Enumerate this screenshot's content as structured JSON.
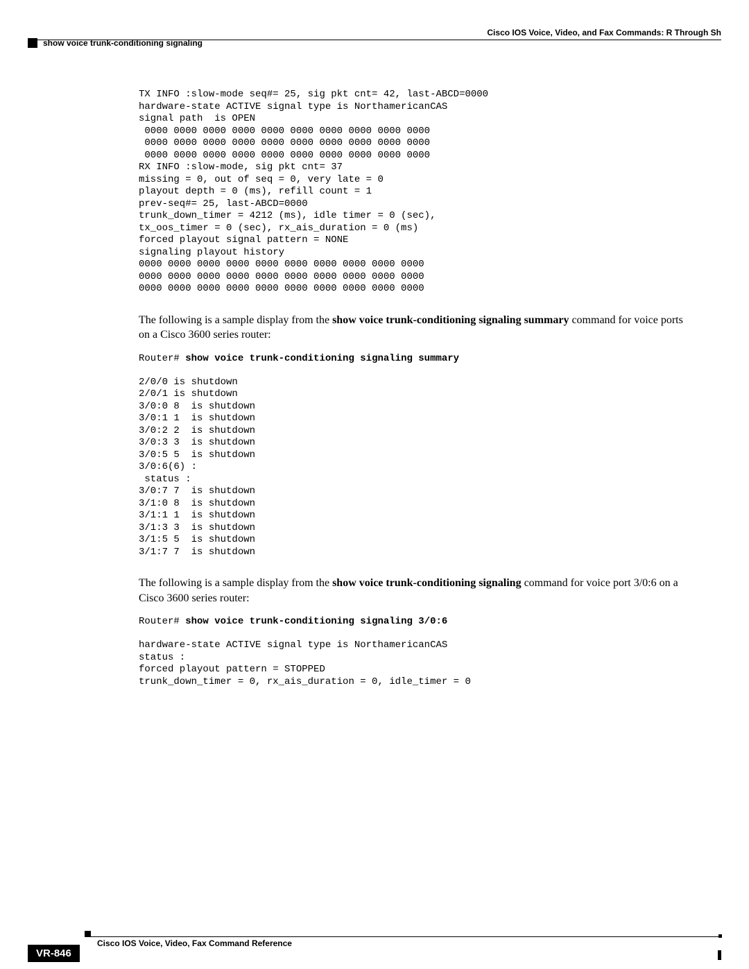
{
  "header": {
    "right_text": "Cisco IOS Voice, Video, and Fax Commands: R Through Sh",
    "left_text": "show voice trunk-conditioning signaling"
  },
  "block1": {
    "lines": [
      "TX INFO :slow-mode seq#= 25, sig pkt cnt= 42, last-ABCD=0000",
      "hardware-state ACTIVE signal type is NorthamericanCAS",
      "signal path  is OPEN",
      " 0000 0000 0000 0000 0000 0000 0000 0000 0000 0000",
      " 0000 0000 0000 0000 0000 0000 0000 0000 0000 0000",
      " 0000 0000 0000 0000 0000 0000 0000 0000 0000 0000",
      "RX INFO :slow-mode, sig pkt cnt= 37",
      "missing = 0, out of seq = 0, very late = 0",
      "playout depth = 0 (ms), refill count = 1",
      "prev-seq#= 25, last-ABCD=0000",
      "trunk_down_timer = 4212 (ms), idle timer = 0 (sec),",
      "tx_oos_timer = 0 (sec), rx_ais_duration = 0 (ms)",
      "forced playout signal pattern = NONE",
      "signaling playout history",
      "0000 0000 0000 0000 0000 0000 0000 0000 0000 0000",
      "0000 0000 0000 0000 0000 0000 0000 0000 0000 0000",
      "0000 0000 0000 0000 0000 0000 0000 0000 0000 0000"
    ]
  },
  "para1": {
    "pre": "The following is a sample display from the ",
    "bold": "show voice trunk-conditioning signaling summary",
    "post": " command for voice ports on a Cisco 3600 series router:"
  },
  "cmd1": {
    "prompt": "Router# ",
    "cmd": "show voice trunk-conditioning signaling summary"
  },
  "block2": {
    "lines": [
      "2/0/0 is shutdown",
      "2/0/1 is shutdown",
      "3/0:0 8  is shutdown",
      "3/0:1 1  is shutdown",
      "3/0:2 2  is shutdown",
      "3/0:3 3  is shutdown",
      "3/0:5 5  is shutdown",
      "3/0:6(6) :",
      " status :",
      "3/0:7 7  is shutdown",
      "3/1:0 8  is shutdown",
      "3/1:1 1  is shutdown",
      "3/1:3 3  is shutdown",
      "3/1:5 5  is shutdown",
      "3/1:7 7  is shutdown"
    ]
  },
  "para2": {
    "pre": "The following is a sample display from the ",
    "bold": "show voice trunk-conditioning signaling",
    "post": " command for voice port 3/0:6 on a Cisco 3600 series router:"
  },
  "cmd2": {
    "prompt": "Router# ",
    "cmd": "show voice trunk-conditioning signaling 3/0:6"
  },
  "block3": {
    "lines": [
      "hardware-state ACTIVE signal type is NorthamericanCAS",
      "status :",
      "forced playout pattern = STOPPED",
      "trunk_down_timer = 0, rx_ais_duration = 0, idle_timer = 0"
    ]
  },
  "footer": {
    "text": "Cisco IOS Voice, Video, Fax Command Reference",
    "page_num": "VR-846"
  }
}
